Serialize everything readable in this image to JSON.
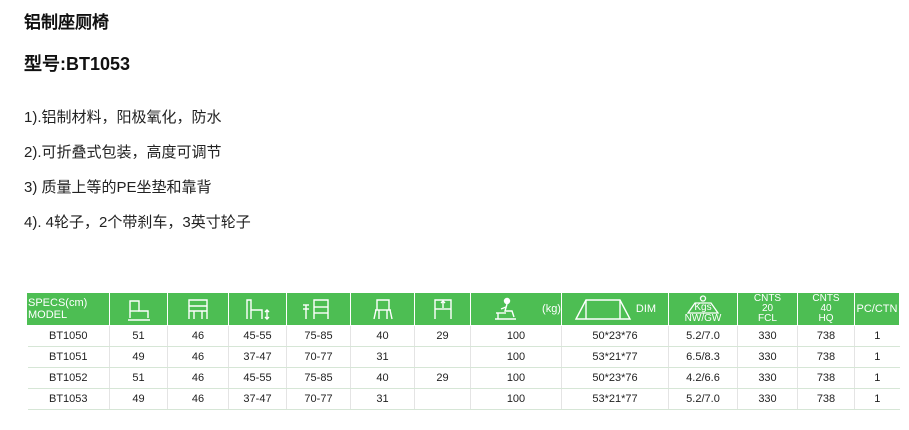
{
  "title": "铝制座厕椅",
  "model_line": "型号:BT1053",
  "features": [
    "1).铝制材料，阳极氧化，防水",
    "2).可折叠式包装，高度可调节",
    "3) 质量上等的PE坐垫和靠背",
    "4). 4轮子，2个带刹车，3英寸轮子"
  ],
  "table": {
    "header": {
      "specs_label": "SPECS(cm)",
      "model_label": "MODEL",
      "load_unit": "(kg)",
      "dim_label": "DIM",
      "weight_unit": "Kgs",
      "weight_label": "NW/GW",
      "fcl20_line1": "CNTS",
      "fcl20_line2": "20",
      "fcl20_line3": "FCL",
      "hq40_line1": "CNTS",
      "hq40_line2": "40",
      "hq40_line3": "HQ",
      "pc_ctn": "PC/CTN"
    },
    "column_icons": [
      "chair-width-icon",
      "seat-width-icon",
      "seat-height-icon",
      "armrest-height-icon",
      "seat-depth-icon",
      "back-height-icon",
      "max-load-icon",
      "carton-icon",
      "weight-icon"
    ],
    "rows": [
      {
        "model": "BT1050",
        "c1": "51",
        "c2": "46",
        "c3": "45-55",
        "c4": "75-85",
        "c5": "40",
        "c6": "29",
        "c7": "100",
        "dim": "50*23*76",
        "nwgw": "5.2/7.0",
        "fcl20": "330",
        "hq40": "738",
        "pc": "1"
      },
      {
        "model": "BT1051",
        "c1": "49",
        "c2": "46",
        "c3": "37-47",
        "c4": "70-77",
        "c5": "31",
        "c6": "",
        "c7": "100",
        "dim": "53*21*77",
        "nwgw": "6.5/8.3",
        "fcl20": "330",
        "hq40": "738",
        "pc": "1"
      },
      {
        "model": "BT1052",
        "c1": "51",
        "c2": "46",
        "c3": "45-55",
        "c4": "75-85",
        "c5": "40",
        "c6": "29",
        "c7": "100",
        "dim": "50*23*76",
        "nwgw": "4.2/6.6",
        "fcl20": "330",
        "hq40": "738",
        "pc": "1"
      },
      {
        "model": "BT1053",
        "c1": "49",
        "c2": "46",
        "c3": "37-47",
        "c4": "70-77",
        "c5": "31",
        "c6": "",
        "c7": "100",
        "dim": "53*21*77",
        "nwgw": "5.2/7.0",
        "fcl20": "330",
        "hq40": "738",
        "pc": "1"
      }
    ]
  }
}
